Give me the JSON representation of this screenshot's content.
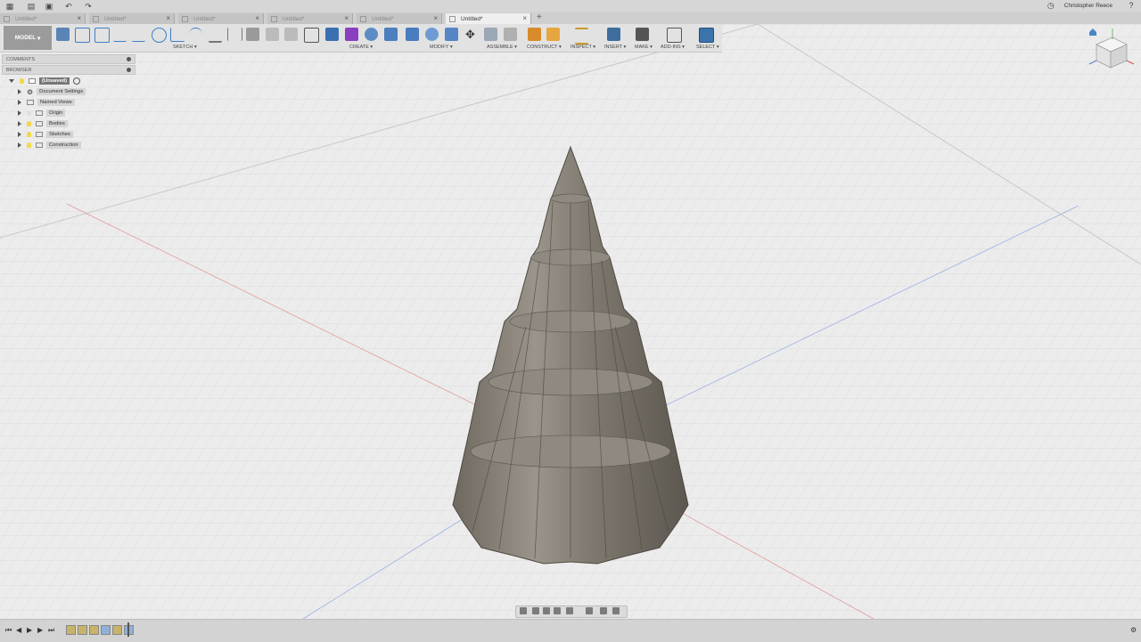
{
  "app": {
    "user_name": "Christopher Reece",
    "workspace": "MODEL"
  },
  "tabs": [
    {
      "label": "Untitled*",
      "active": false
    },
    {
      "label": "Untitled*",
      "active": false
    },
    {
      "label": "Untitled*",
      "active": false
    },
    {
      "label": "Untitled*",
      "active": false
    },
    {
      "label": "Untitled*",
      "active": false
    },
    {
      "label": "Untitled*",
      "active": true
    }
  ],
  "toolbar": {
    "groups": [
      "SKETCH ▾",
      "CREATE ▾",
      "MODIFY ▾",
      "ASSEMBLE ▾",
      "CONSTRUCT ▾",
      "INSPECT ▾",
      "INSERT ▾",
      "MAKE ▾",
      "ADD-INS ▾",
      "SELECT ▾"
    ]
  },
  "panels": {
    "comments": "COMMENTS",
    "browser": "BROWSER"
  },
  "browser_tree": {
    "root": "(Unsaved)",
    "items": [
      "Document Settings",
      "Named Views",
      "Origin",
      "Bodies",
      "Sketches",
      "Construction"
    ]
  },
  "colors": {
    "accent": "#4a86c5",
    "model_fill": "#8b8478",
    "grid": "#d2d2d2"
  }
}
